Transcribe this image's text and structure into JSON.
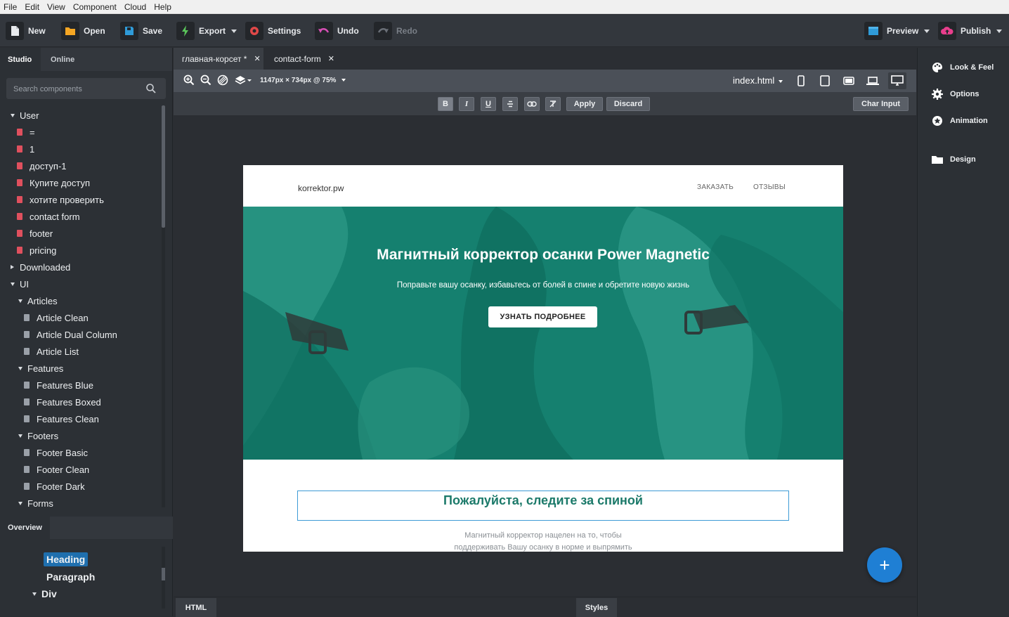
{
  "menu": [
    "File",
    "Edit",
    "View",
    "Component",
    "Cloud",
    "Help"
  ],
  "toolbar": {
    "new": "New",
    "open": "Open",
    "save": "Save",
    "export": "Export",
    "settings": "Settings",
    "undo": "Undo",
    "redo": "Redo",
    "preview": "Preview",
    "publish": "Publish"
  },
  "left": {
    "tabs": [
      "Studio",
      "Online"
    ],
    "search_placeholder": "Search components",
    "tree": {
      "user": "User",
      "user_items": [
        "=",
        "1",
        "доступ-1",
        "Купите доступ",
        "хотите проверить",
        "contact form",
        "footer",
        "pricing"
      ],
      "downloaded": "Downloaded",
      "ui": "UI",
      "articles": "Articles",
      "articles_items": [
        "Article Clean",
        "Article Dual Column",
        "Article List"
      ],
      "features": "Features",
      "features_items": [
        "Features Blue",
        "Features Boxed",
        "Features Clean"
      ],
      "footers": "Footers",
      "footers_items": [
        "Footer Basic",
        "Footer Clean",
        "Footer Dark"
      ],
      "forms": "Forms"
    },
    "overview_tab": "Overview",
    "overview": {
      "heading": "Heading",
      "paragraph": "Paragraph",
      "div": "Div"
    }
  },
  "center": {
    "file_tabs": [
      {
        "label": "главная-корсет *"
      },
      {
        "label": "contact-form"
      }
    ],
    "dims": "1147px × 734px @ 75%",
    "file": "index.html",
    "format": {
      "bold": "B",
      "italic": "I",
      "underline": "U",
      "apply": "Apply",
      "discard": "Discard",
      "char_input": "Char Input"
    },
    "page": {
      "brand": "korrektor.pw",
      "nav": [
        "ЗАКАЗАТЬ",
        "ОТЗЫВЫ"
      ],
      "hero_title": "Магнитный корректор осанки Power Magnetic",
      "hero_sub": "Поправьте вашу осанку, избавьтесь от болей в спине и обретите новую жизнь",
      "hero_button": "УЗНАТЬ ПОДРОБНЕЕ",
      "section_heading": "Пожалуйста, следите за спиной",
      "section_p1": "Магнитный корректор нацелен на то, чтобы",
      "section_p2": "поддерживать Вашу осанку в норме и выпрямить"
    },
    "bottom_tabs": [
      "HTML",
      "Styles"
    ],
    "fab": "+"
  },
  "right": {
    "items": [
      "Look & Feel",
      "Options",
      "Animation",
      "Design"
    ]
  },
  "colors": {
    "accent": "#1f7fd4",
    "hero": "#1a8a78",
    "heading": "#1c7a6a",
    "book": "#e0505e"
  }
}
